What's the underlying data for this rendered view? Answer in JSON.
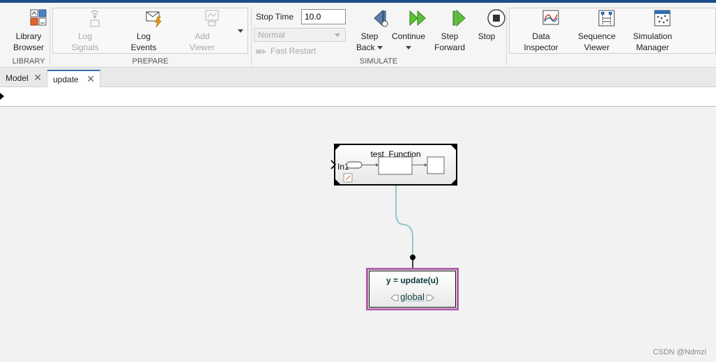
{
  "ribbon": {
    "library": {
      "button": "Library Browser",
      "line1": "Library",
      "line2": "Browser",
      "section": "LIBRARY"
    },
    "prepare": {
      "section": "PREPARE",
      "log_signals": {
        "line1": "Log",
        "line2": "Signals"
      },
      "log_events": {
        "line1": "Log",
        "line2": "Events"
      },
      "add_viewer": {
        "line1": "Add",
        "line2": "Viewer"
      }
    },
    "simulate": {
      "section": "SIMULATE",
      "stop_time_label": "Stop Time",
      "stop_time_value": "10.0",
      "mode_value": "Normal",
      "fast_restart": "Fast Restart",
      "step_back": {
        "line1": "Step",
        "line2": "Back"
      },
      "continue": "Continue",
      "step_forward": {
        "line1": "Step",
        "line2": "Forward"
      },
      "stop": "Stop"
    },
    "review": {
      "data_inspector": {
        "line1": "Data",
        "line2": "Inspector"
      },
      "sequence_viewer": {
        "line1": "Sequence",
        "line2": "Viewer"
      },
      "simulation_manager": {
        "line1": "Simulation",
        "line2": "Manager"
      }
    }
  },
  "tabs": [
    {
      "label": "Model",
      "active": false
    },
    {
      "label": "update",
      "active": true
    }
  ],
  "canvas": {
    "block_test_function": {
      "title": "test_Function",
      "port_label": "In1"
    },
    "block_update": {
      "title": "y = update(u)",
      "scope": "global"
    }
  },
  "watermark": "CSDN @Ndmzi",
  "colors": {
    "accent": "#1e4f8c",
    "selection_magenta": "#b160a8",
    "signal_line": "#8fc9cc"
  },
  "icons": {
    "library": "library-browser-icon",
    "log_signals": "log-signals-icon",
    "log_events": "log-events-icon",
    "add_viewer": "add-viewer-icon",
    "step_back": "step-back-icon",
    "continue": "continue-icon",
    "step_forward": "step-forward-icon",
    "stop": "stop-icon",
    "data_inspector": "data-inspector-icon",
    "sequence_viewer": "sequence-viewer-icon",
    "simulation_manager": "simulation-manager-icon"
  }
}
